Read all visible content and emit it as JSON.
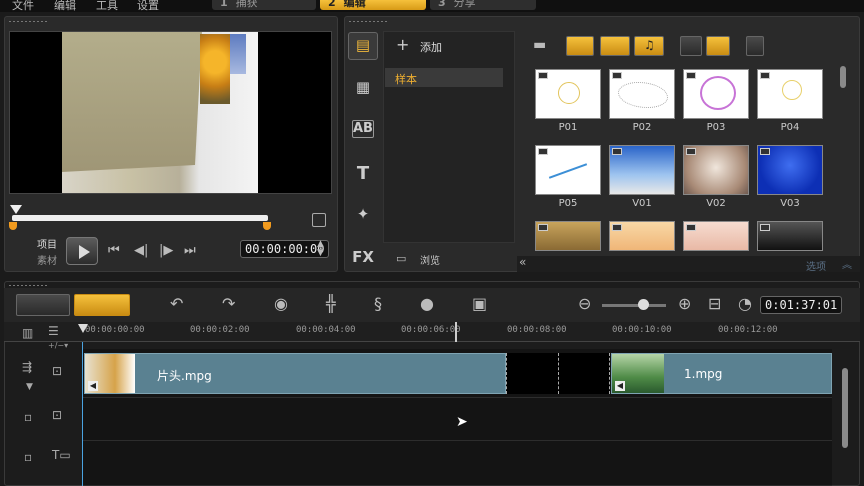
{
  "menu": [
    "文件",
    "编辑",
    "工具",
    "设置"
  ],
  "steps": [
    {
      "num": "1",
      "label": "捕获"
    },
    {
      "num": "2",
      "label": "编辑"
    },
    {
      "num": "3",
      "label": "分享"
    }
  ],
  "player": {
    "mode_project": "项目",
    "mode_clip": "素材",
    "timecode": "00:00:00:00"
  },
  "library": {
    "add_label": "添加",
    "folder": "样本",
    "browse_label": "浏览",
    "options_label": "选项",
    "side_icons": [
      "media-icon",
      "transition-icon",
      "title-ab-icon",
      "text-t-icon",
      "graphics-icon",
      "fx-icon"
    ],
    "side_glyphs": [
      "",
      "",
      "AB",
      "T",
      "",
      "FX"
    ],
    "thumbnails": [
      {
        "label": "P01",
        "style": "sun"
      },
      {
        "label": "P02",
        "style": "map"
      },
      {
        "label": "P03",
        "style": "face"
      },
      {
        "label": "P04",
        "style": "sun2"
      },
      {
        "label": "P05",
        "style": "plane"
      },
      {
        "label": "V01",
        "style": "sky"
      },
      {
        "label": "V02",
        "style": "cloud"
      },
      {
        "label": "V03",
        "style": "blue"
      },
      {
        "label": "",
        "style": "brown"
      },
      {
        "label": "",
        "style": "peach"
      },
      {
        "label": "",
        "style": "pink"
      },
      {
        "label": "",
        "style": "dark"
      }
    ]
  },
  "timeline": {
    "duration": "0:01:37:01",
    "ruler": [
      "00:00:00:00",
      "00:00:02:00",
      "00:00:04:00",
      "00:00:06:00",
      "00:00:08:00",
      "00:00:10:00",
      "00:00:12:00"
    ],
    "clips": [
      {
        "name": "片头.mpg"
      },
      {
        "name": "1.mpg"
      }
    ]
  }
}
